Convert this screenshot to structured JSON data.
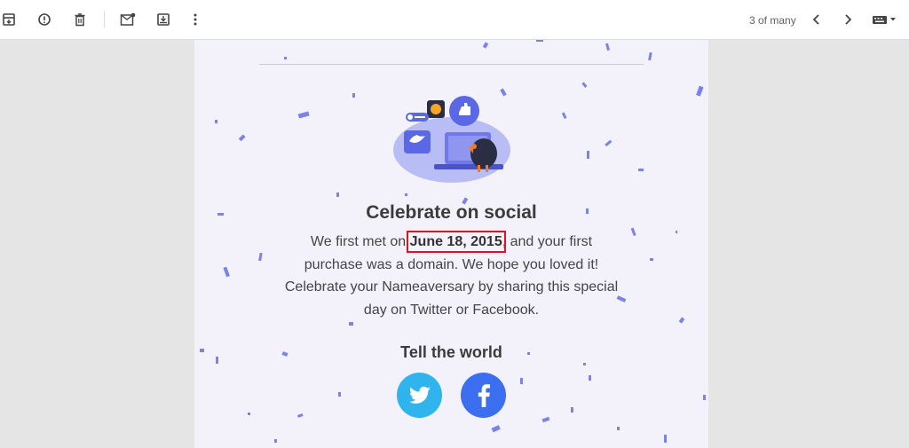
{
  "toolbar": {
    "icons": [
      "archive-icon",
      "report-spam-icon",
      "delete-icon",
      "mark-unread-icon",
      "move-to-icon",
      "more-options-icon"
    ],
    "pager_text": "3 of many",
    "input_tools": "keyboard-icon"
  },
  "email": {
    "heading": "Celebrate on social",
    "para_before": "We first met on ",
    "date": "June 18, 2015",
    "para_after": ", and your first purchase was a domain. We hope you loved it! Celebrate your Nameaversary by sharing this special day on Twitter or Facebook.",
    "subheading": "Tell the world",
    "social": [
      "twitter-icon",
      "facebook-icon"
    ]
  },
  "colors": {
    "email_bg": "#f3f2fb",
    "confetti": "#7b82e8",
    "twitter": "#30b4ee",
    "facebook": "#3b6ff0",
    "highlight": "#e0141e"
  }
}
